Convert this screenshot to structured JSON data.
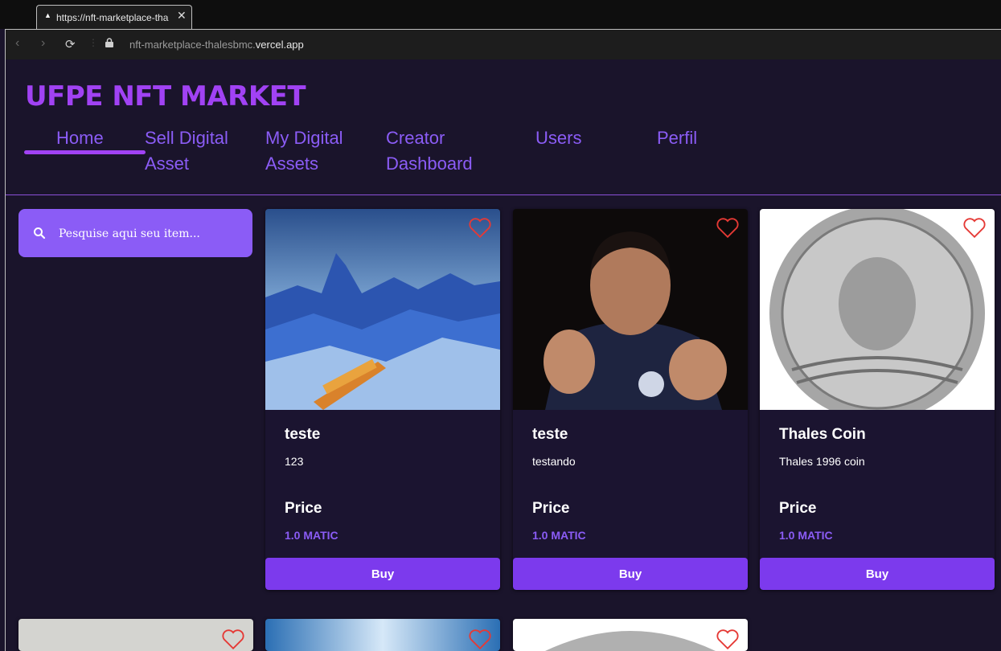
{
  "browser": {
    "tab_title": "https://nft-marketplace-tha",
    "url_prefix": "nft-marketplace-thalesbmc.",
    "url_domain": "vercel.app"
  },
  "brand": "UFPE NFT MARKET",
  "nav": [
    {
      "label": "Home",
      "active": true
    },
    {
      "label": "Sell Digital Asset"
    },
    {
      "label": "My Digital Assets"
    },
    {
      "label": "Creator Dashboard"
    },
    {
      "label": "Users"
    },
    {
      "label": "Perfil"
    }
  ],
  "search": {
    "placeholder": "Pesquise aqui seu item..."
  },
  "cards": [
    {
      "name": "teste",
      "description": "123",
      "price_label": "Price",
      "price": "1.0 MATIC",
      "buy_label": "Buy",
      "image": "mountain-train-photo"
    },
    {
      "name": "teste",
      "description": "testando",
      "price_label": "Price",
      "price": "1.0 MATIC",
      "buy_label": "Buy",
      "image": "person-photo"
    },
    {
      "name": "Thales Coin",
      "description": "Thales 1996 coin",
      "price_label": "Price",
      "price": "1.0 MATIC",
      "buy_label": "Buy",
      "image": "coin-photo"
    }
  ],
  "colors": {
    "accent": "#a142f4",
    "nav": "#8b5cf6",
    "button": "#7c3aed",
    "background": "#1a142b",
    "heart": "#e53935"
  }
}
